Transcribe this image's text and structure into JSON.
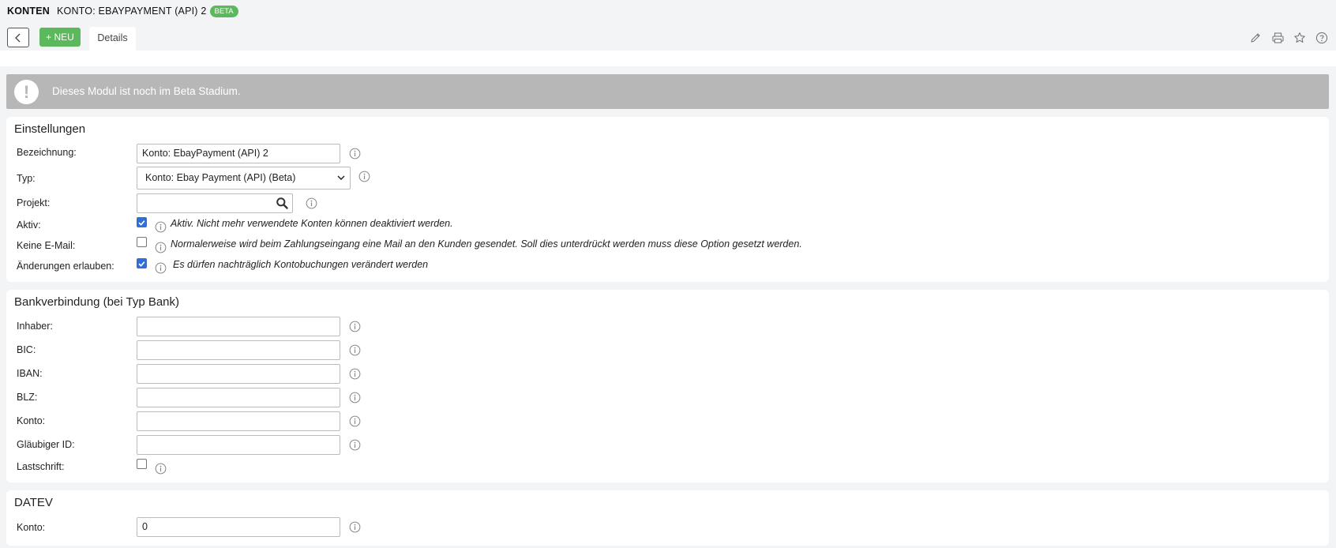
{
  "header": {
    "module": "KONTEN",
    "title": "KONTO: EBAYPAYMENT (API) 2",
    "badge": "BETA",
    "new_label": "+ NEU",
    "tab_details": "Details"
  },
  "alert": {
    "message": "Dieses Modul ist noch im Beta Stadium."
  },
  "settings": {
    "title": "Einstellungen",
    "bezeichnung": {
      "label": "Bezeichnung:",
      "value": "Konto: EbayPayment (API) 2"
    },
    "typ": {
      "label": "Typ:",
      "value": "Konto: Ebay Payment (API) (Beta)"
    },
    "projekt": {
      "label": "Projekt:",
      "value": ""
    },
    "aktiv": {
      "label": "Aktiv:",
      "checked": true,
      "hint": "Aktiv. Nicht mehr verwendete Konten können deaktiviert werden."
    },
    "keine_email": {
      "label": "Keine E-Mail:",
      "checked": false,
      "hint": "Normalerweise wird beim Zahlungseingang eine Mail an den Kunden gesendet. Soll dies unterdrückt werden muss diese Option gesetzt werden."
    },
    "aenderungen": {
      "label": "Änderungen erlauben:",
      "checked": true,
      "hint": "Es dürfen nachträglich Kontobuchungen verändert werden"
    }
  },
  "bank": {
    "title": "Bankverbindung (bei Typ Bank)",
    "inhaber": {
      "label": "Inhaber:",
      "value": ""
    },
    "bic": {
      "label": "BIC:",
      "value": ""
    },
    "iban": {
      "label": "IBAN:",
      "value": ""
    },
    "blz": {
      "label": "BLZ:",
      "value": ""
    },
    "konto": {
      "label": "Konto:",
      "value": ""
    },
    "glaeubiger": {
      "label": "Gläubiger ID:",
      "value": ""
    },
    "lastschrift": {
      "label": "Lastschrift:",
      "checked": false
    }
  },
  "datev": {
    "title": "DATEV",
    "konto": {
      "label": "Konto:",
      "value": "0"
    }
  },
  "colors": {
    "accent_green": "#5cb85c",
    "alert_gray": "#b7b7b7",
    "checkbox_blue": "#2f6fd8"
  }
}
